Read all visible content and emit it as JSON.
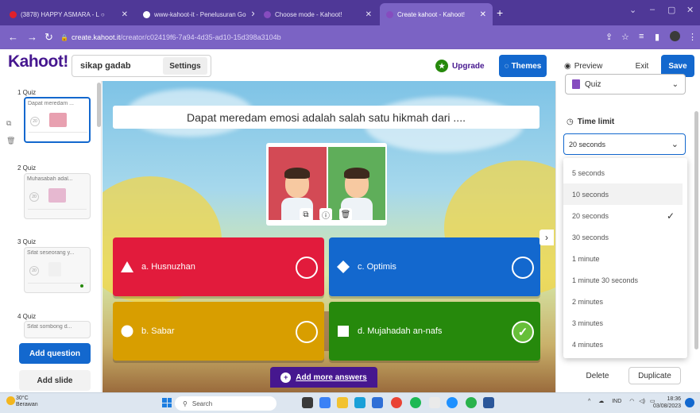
{
  "browser": {
    "tabs": [
      {
        "label": "(3878) HAPPY ASMARA - L ○",
        "fav_color": "#e0202a"
      },
      {
        "label": "www-kahoot-it - Penelusuran Go",
        "fav_color": "#ffffff"
      },
      {
        "label": "Choose mode - Kahoot!",
        "fav_color": "#864cbf"
      },
      {
        "label": "Create kahoot - Kahoot!",
        "fav_color": "#864cbf"
      }
    ],
    "url_host": "create.kahoot.it",
    "url_path": "/creator/c02419f6-7a94-4d35-ad10-15d398a3104b"
  },
  "header": {
    "logo": "Kahoot!",
    "kahoot_title": "sikap gadab",
    "settings": "Settings",
    "upgrade": "Upgrade",
    "themes": "Themes",
    "preview": "Preview",
    "exit": "Exit",
    "save": "Save"
  },
  "sidebar": {
    "slides": [
      {
        "label": "1 Quiz",
        "text": "Dapat meredam ..."
      },
      {
        "label": "2 Quiz",
        "text": "Muhasabah adal..."
      },
      {
        "label": "3 Quiz",
        "text": "Sifat seseorang y..."
      },
      {
        "label": "4 Quiz",
        "text": "Sifat sombong d..."
      }
    ],
    "add_question": "Add question",
    "add_slide": "Add slide"
  },
  "question": {
    "text": "Dapat meredam emosi adalah salah satu hikmah dari ....",
    "answers": [
      {
        "text": "a. Husnuzhan",
        "shape": "triangle",
        "correct": false
      },
      {
        "text": "c. Optimis",
        "shape": "diamond",
        "correct": false
      },
      {
        "text": "b. Sabar",
        "shape": "circle",
        "correct": false
      },
      {
        "text": "d. Mujahadah an-nafs",
        "shape": "square",
        "correct": true
      }
    ],
    "add_more": "Add more answers"
  },
  "right_panel": {
    "question_type": "Quiz",
    "time_limit_label": "Time limit",
    "time_limit_value": "20 seconds",
    "options": [
      "5 seconds",
      "10 seconds",
      "20 seconds",
      "30 seconds",
      "1 minute",
      "1 minute 30 seconds",
      "2 minutes",
      "3 minutes",
      "4 minutes"
    ],
    "selected_option": "20 seconds",
    "hovered_option": "10 seconds",
    "delete": "Delete",
    "duplicate": "Duplicate"
  },
  "taskbar": {
    "weather_temp": "30°C",
    "weather_desc": "Berawan",
    "search": "Search",
    "lang": "IND",
    "time": "18:36",
    "date": "03/08/2023"
  },
  "colors": {
    "brand": "#46178f",
    "blue": "#1368ce",
    "red": "#e21b3c",
    "yellow": "#d89e00",
    "green": "#26890c"
  }
}
